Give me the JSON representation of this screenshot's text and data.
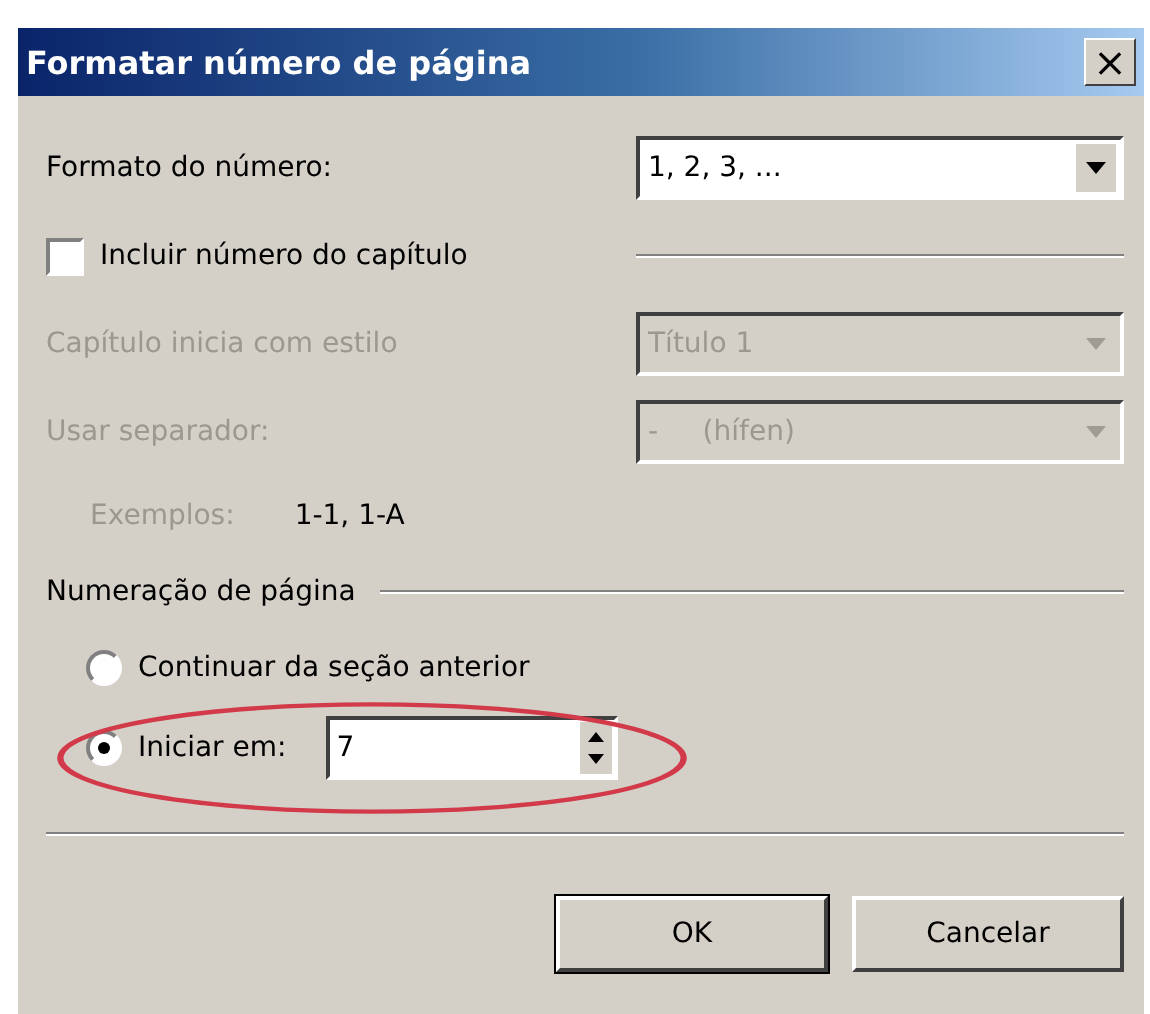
{
  "window": {
    "title": "Formatar número de página",
    "close": "×"
  },
  "number_format": {
    "label": "Formato do número:",
    "value": "1, 2, 3, ...",
    "disabled": false
  },
  "include_chapter": {
    "label": "Incluir número do capítulo",
    "checked": false
  },
  "chapter_style": {
    "label": "Capítulo inicia com estilo",
    "value": "Título 1",
    "disabled": true
  },
  "separator": {
    "label": "Usar separador:",
    "value": "-     (hífen)",
    "disabled": true
  },
  "examples": {
    "label": "Exemplos:",
    "value": "1-1, 1-A"
  },
  "page_numbering": {
    "title": "Numeração de página",
    "options": [
      {
        "label": "Continuar da seção anterior",
        "selected": false
      },
      {
        "label": "Iniciar em:",
        "selected": true,
        "value": "7"
      }
    ]
  },
  "annotation": {
    "kind": "ellipse",
    "color": "#d23a4a"
  },
  "buttons": [
    {
      "label": "OK",
      "default": true
    },
    {
      "label": "Cancelar",
      "default": false
    }
  ]
}
